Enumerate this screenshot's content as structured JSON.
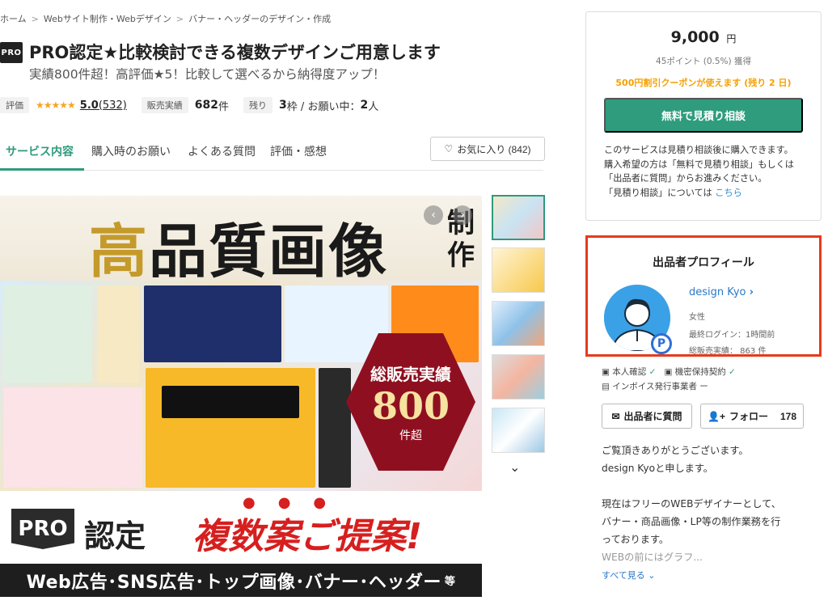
{
  "breadcrumb": [
    "ホーム",
    "Webサイト制作・Webデザイン",
    "バナー・ヘッダーのデザイン・作成"
  ],
  "title": {
    "badge": "PRO",
    "text": "PRO認定★比較検討できる複数デザインご用意します",
    "subtitle": "実績800件超！高評価★5！比較して選べるから納得度アップ！"
  },
  "stats": {
    "rating_label": "評価",
    "stars": "★★★★★",
    "rating": "5.0",
    "reviews": "(532)",
    "sales_label": "販売実績",
    "sales_value": "682",
    "sales_unit": "件",
    "remaining_label": "残り",
    "remaining_value": "3",
    "remaining_text": "枠 / お願い中：",
    "in_progress_value": "2",
    "in_progress_unit": "人"
  },
  "tabs": [
    "サービス内容",
    "購入時のお願い",
    "よくある質問",
    "評価・感想"
  ],
  "favorite": {
    "icon": "heart-icon",
    "label": "お気に入り (842)"
  },
  "hero": {
    "heading_gold": "高",
    "heading_rest": "品質画像",
    "heading_side": "制作",
    "hex_top": "総販売実績",
    "hex_number": "800",
    "hex_bottom": "件超",
    "pro_block": "PRO",
    "certified": "認定",
    "multiple": "複数案ご提案!",
    "dots": "●●●",
    "bottom_text": "Web広告･SNS広告･トップ画像･バナー･ヘッダー",
    "bottom_small": "等"
  },
  "purchase": {
    "price": "9,000",
    "currency": "円",
    "points": "45ポイント (0.5%) 獲得",
    "coupon": "500円割引クーポンが使えます (残り 2 日)",
    "cta": "無料で見積り相談",
    "note_lines": [
      "このサービスは見積り相談後に購入できます。",
      "購入希望の方は「無料で見積り相談」もしくは",
      "「出品者に質問」からお進みください。",
      "「見積り相談」については"
    ],
    "note_link": "こちら"
  },
  "profile": {
    "title": "出品者プロフィール",
    "name": "design Kyo",
    "gender": "女性",
    "last_login": "最終ログイン：1時間前",
    "total_sales": "総販売実績： 863 件",
    "badge": "P"
  },
  "verification": {
    "identity": "本人確認",
    "nda": "機密保持契約",
    "invoice": "インボイス発行事業者",
    "invoice_status": "ー"
  },
  "actions": {
    "ask": "出品者に質問",
    "follow": "フォロー",
    "follow_count": "178"
  },
  "bio": {
    "lines": [
      "ご覧頂きありがとうございます。",
      "design Kyoと申します。",
      "",
      "現在はフリーのWEBデザイナーとして、",
      "バナー・商品画像・LP等の制作業務を行",
      "っております。"
    ],
    "faded": "WEBの前にはグラフ...",
    "more": "すべて見る"
  },
  "colors": {
    "accent": "#2e9c7d",
    "coupon": "#f5a000",
    "highlight_border": "#e63a1e",
    "link": "#2a79c8"
  }
}
